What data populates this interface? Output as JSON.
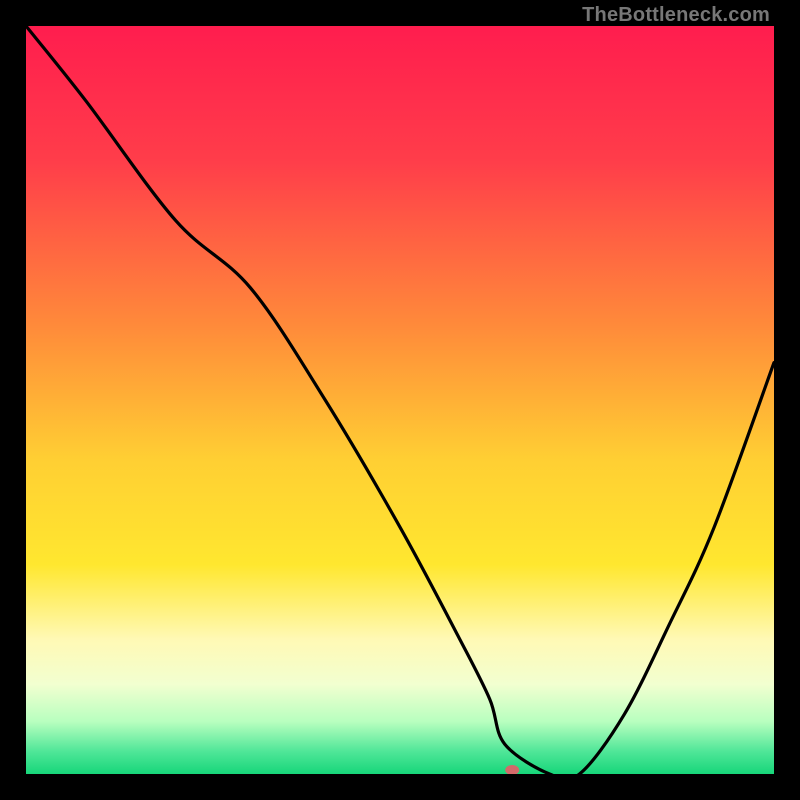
{
  "attribution": "TheBottleneck.com",
  "chart_data": {
    "type": "line",
    "title": "",
    "xlabel": "",
    "ylabel": "",
    "xlim": [
      0,
      100
    ],
    "ylim": [
      0,
      100
    ],
    "x": [
      0,
      8,
      20,
      30,
      40,
      50,
      58,
      62,
      64,
      70,
      74,
      80,
      86,
      92,
      100
    ],
    "values": [
      100,
      90,
      74,
      65,
      50,
      33,
      18,
      10,
      4,
      0,
      0,
      8,
      20,
      33,
      55
    ],
    "marker": {
      "x": 65,
      "y": 0,
      "color": "#d36a6a",
      "rx": 7,
      "ry": 5
    },
    "gradient_stops": [
      {
        "offset": 0.0,
        "color": "#ff1d4e"
      },
      {
        "offset": 0.18,
        "color": "#ff3d4a"
      },
      {
        "offset": 0.4,
        "color": "#ff8a3a"
      },
      {
        "offset": 0.58,
        "color": "#ffcf33"
      },
      {
        "offset": 0.72,
        "color": "#ffe72f"
      },
      {
        "offset": 0.82,
        "color": "#fff9b5"
      },
      {
        "offset": 0.88,
        "color": "#f2ffd0"
      },
      {
        "offset": 0.93,
        "color": "#b8ffbf"
      },
      {
        "offset": 0.97,
        "color": "#4fe698"
      },
      {
        "offset": 1.0,
        "color": "#17d67a"
      }
    ]
  }
}
